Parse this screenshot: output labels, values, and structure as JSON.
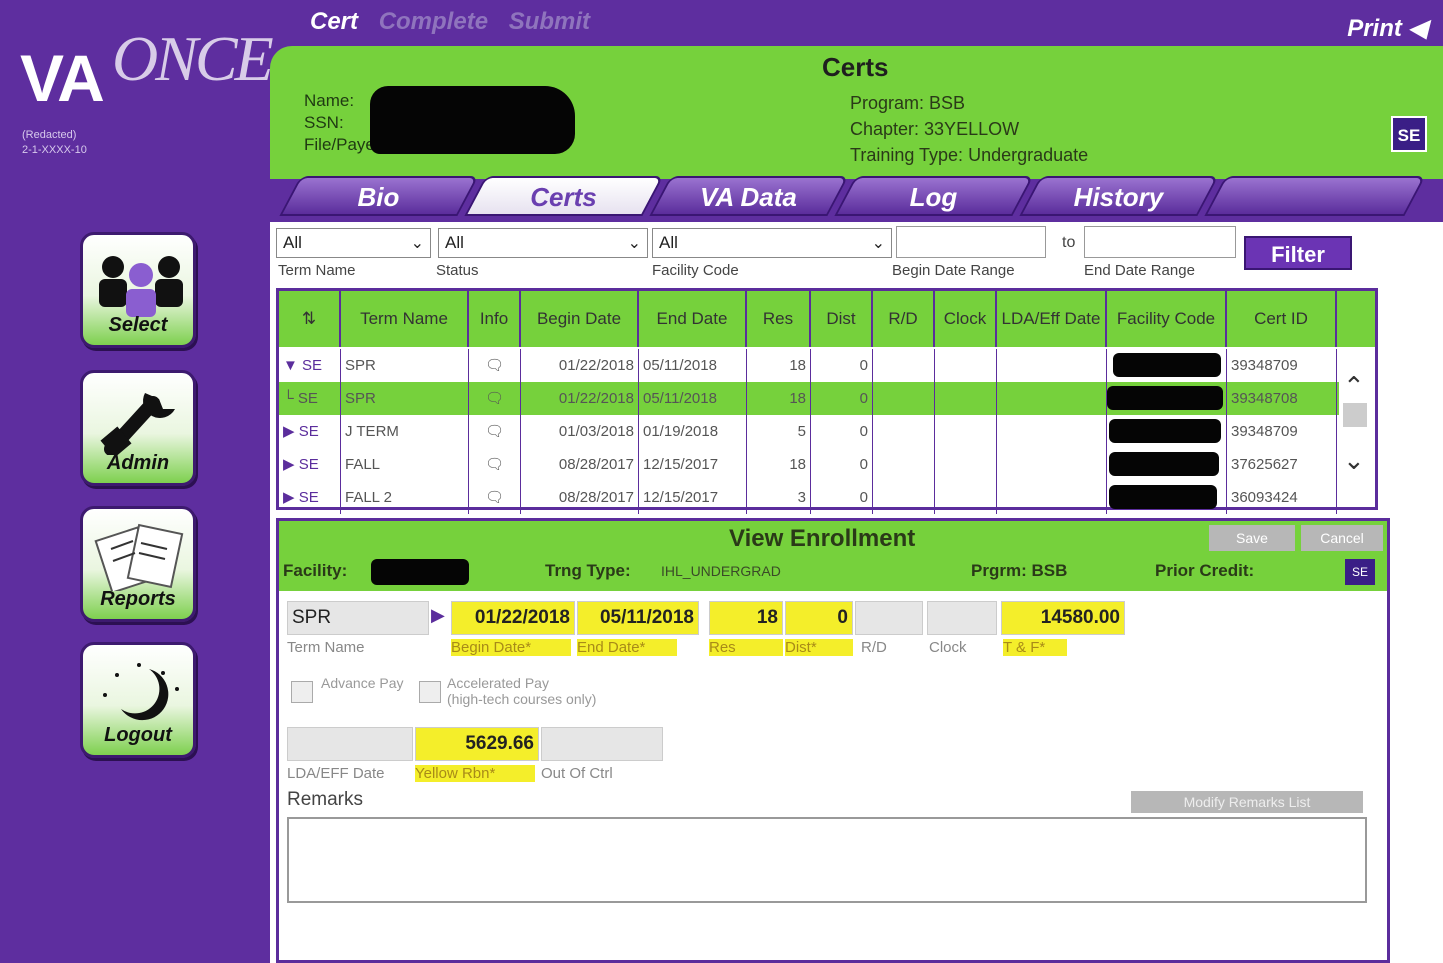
{
  "logo": {
    "va": "VA",
    "once": "ONCE"
  },
  "user": {
    "name": "(Redacted)",
    "id": "2-1-XXXX-10"
  },
  "nav": [
    {
      "label": "Select"
    },
    {
      "label": "Admin"
    },
    {
      "label": "Reports"
    },
    {
      "label": "Logout"
    }
  ],
  "topnav": {
    "cert": "Cert",
    "complete": "Complete",
    "submit": "Submit",
    "print": "Print"
  },
  "header": {
    "title": "Certs",
    "name_label": "Name:",
    "ssn_label": "SSN:",
    "file_label": "File/Payee:",
    "program": "Program: BSB",
    "chapter": "Chapter: 33YELLOW",
    "training_type": "Training Type: Undergraduate",
    "se_badge": "SE"
  },
  "tabs": [
    "Bio",
    "Certs",
    "VA Data",
    "Log",
    "History"
  ],
  "filters": {
    "term_value": "All",
    "status_value": "All",
    "facility_value": "All",
    "term_label": "Term Name",
    "status_label": "Status",
    "facility_label": "Facility Code",
    "begin_label": "Begin Date Range",
    "to_label": "to",
    "end_label": "End Date Range",
    "filter_button": "Filter"
  },
  "grid": {
    "columns": [
      "Term Name",
      "Info",
      "Begin Date",
      "End Date",
      "Res",
      "Dist",
      "R/D",
      "Clock",
      "LDA/Eff Date",
      "Facility Code",
      "Cert ID"
    ],
    "rows": [
      {
        "marker": "▼",
        "type": "SE",
        "term": "SPR",
        "begin": "01/22/2018",
        "end": "05/11/2018",
        "res": "18",
        "dist": "0",
        "cert": "39348709"
      },
      {
        "marker": "└",
        "type": "SE",
        "term": "SPR",
        "begin": "01/22/2018",
        "end": "05/11/2018",
        "res": "18",
        "dist": "0",
        "cert": "39348708"
      },
      {
        "marker": "▶",
        "type": "SE",
        "term": "J TERM",
        "begin": "01/03/2018",
        "end": "01/19/2018",
        "res": "5",
        "dist": "0",
        "cert": "39348709"
      },
      {
        "marker": "▶",
        "type": "SE",
        "term": "FALL",
        "begin": "08/28/2017",
        "end": "12/15/2017",
        "res": "18",
        "dist": "0",
        "cert": "37625627"
      },
      {
        "marker": "▶",
        "type": "SE",
        "term": "FALL 2",
        "begin": "08/28/2017",
        "end": "12/15/2017",
        "res": "3",
        "dist": "0",
        "cert": "36093424"
      }
    ]
  },
  "enrollment": {
    "title": "View Enrollment",
    "save_button": "Save",
    "cancel_button": "Cancel",
    "facility_label": "Facility:",
    "trng_type_label": "Trng Type:",
    "trng_type_value": "IHL_UNDERGRAD",
    "prgrm_label": "Prgrm: BSB",
    "prior_credit_label": "Prior Credit:",
    "se_badge": "SE",
    "term_name": "SPR",
    "begin_date": "01/22/2018",
    "end_date": "05/11/2018",
    "res": "18",
    "dist": "0",
    "tf": "14580.00",
    "labels": {
      "term_name": "Term Name",
      "begin_date": "Begin Date*",
      "end_date": "End Date*",
      "res": "Res",
      "dist": "Dist*",
      "rd": "R/D",
      "clock": "Clock",
      "tf": "T & F*"
    },
    "advance_pay": "Advance Pay",
    "accelerated_pay": "Accelerated Pay",
    "accelerated_note": "(high-tech courses only)",
    "yellow_rbn_value": "5629.66",
    "lda_label": "LDA/EFF Date",
    "yellow_rbn_label": "Yellow Rbn*",
    "out_of_ctrl_label": "Out Of Ctrl",
    "remarks_label": "Remarks",
    "remarks_button": "Modify Remarks List"
  },
  "colors": {
    "purple": "#5e2e9f",
    "green": "#76d13c",
    "highlight": "#f4ee2a"
  }
}
